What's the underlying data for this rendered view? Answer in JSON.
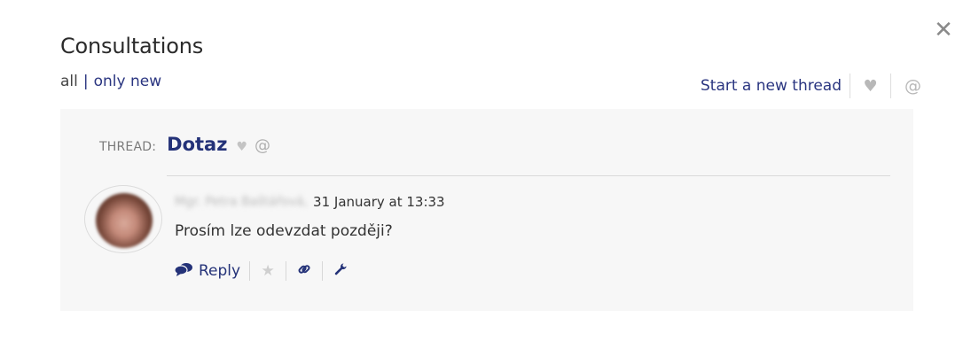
{
  "header": {
    "title": "Consultations",
    "close_icon": "close-icon",
    "close_glyph": "✕"
  },
  "filters": {
    "all_label": "all",
    "separator": "|",
    "only_new_label": "only new"
  },
  "top_actions": {
    "start_thread_label": "Start a new thread",
    "heart_icon": "heart-icon",
    "heart_glyph": "♥",
    "mention_icon": "at-icon",
    "mention_glyph": "@"
  },
  "thread": {
    "label": "THREAD:",
    "title": "Dotaz",
    "heart_glyph": "♥",
    "mention_glyph": "@"
  },
  "post": {
    "author": "Mgr. Petra Baštářová,",
    "timestamp": "31 January at 13:33",
    "message": "Prosím lze odevzdat později?",
    "actions": {
      "reply_glyph": "💬",
      "reply_label": "Reply",
      "star_glyph": "★",
      "link_glyph": "🔗",
      "wrench_glyph": "🔧"
    }
  },
  "colors": {
    "accent": "#243278",
    "panel_bg": "#f7f7f7",
    "muted_icon": "#b8b8b8"
  }
}
